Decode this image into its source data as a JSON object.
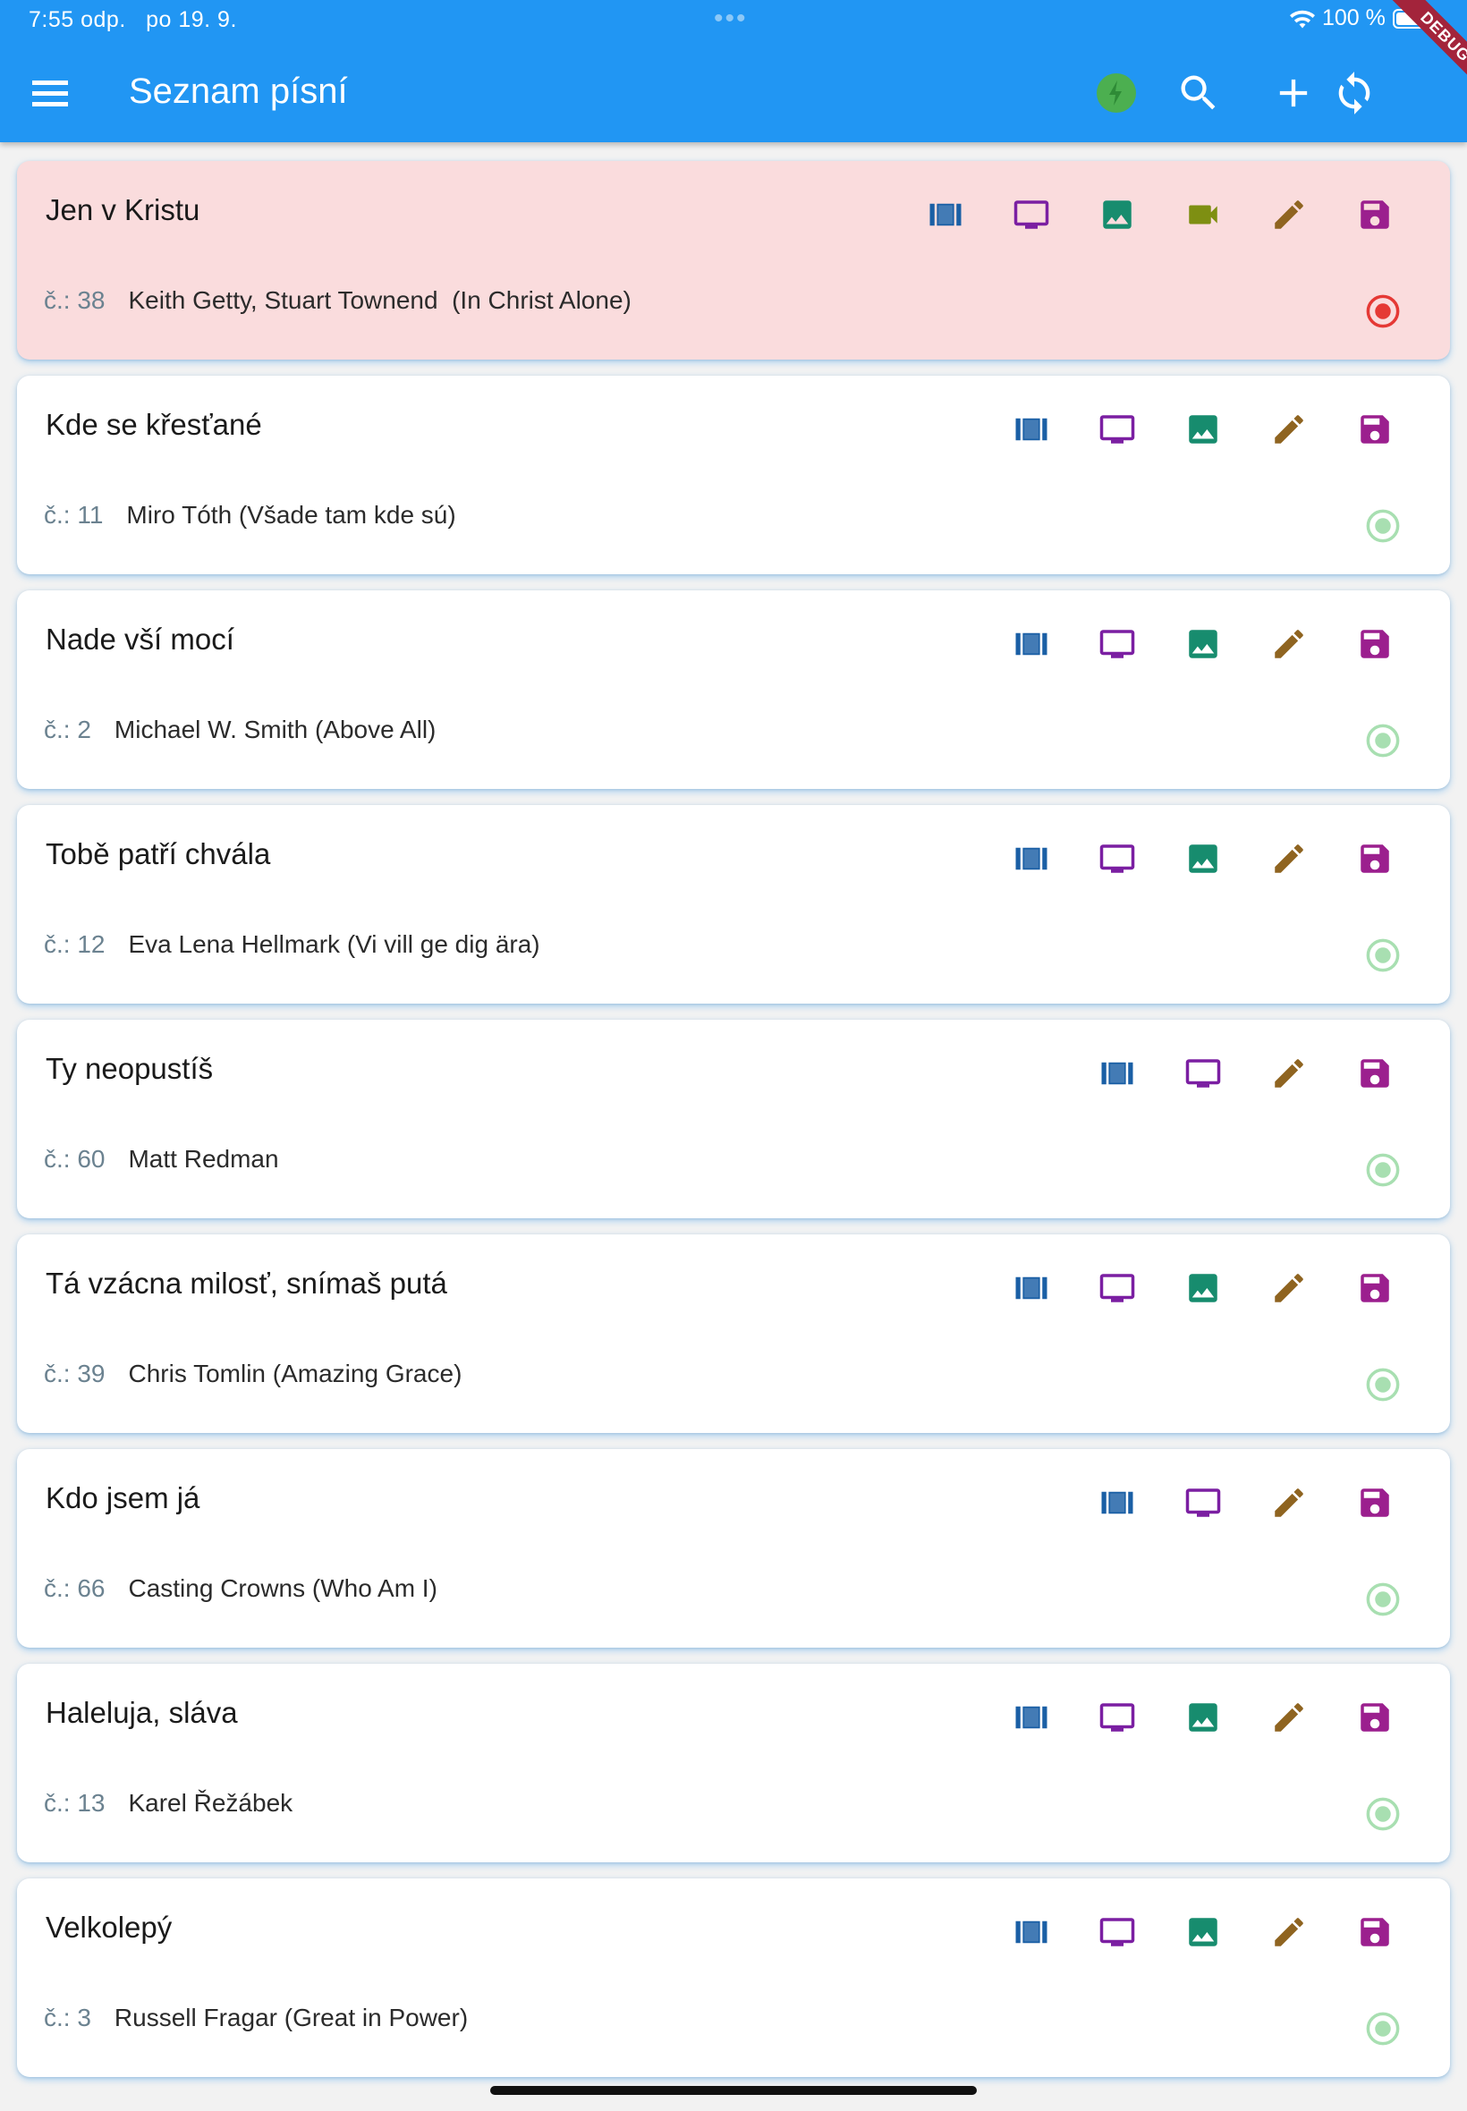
{
  "status_bar": {
    "time": "7:55 odp.",
    "date": "po 19. 9.",
    "battery": "100 %"
  },
  "debug_banner": "DEBUG",
  "app_bar": {
    "title": "Seznam písní",
    "icons": [
      "menu-icon",
      "status-dot-icon",
      "search-icon",
      "add-icon",
      "sync-icon"
    ]
  },
  "colors": {
    "app_bar": "#2196f3",
    "active_card": "#fadcdd",
    "slides_icon": "#1a5fa5",
    "presentation_icon": "#7b1fa2",
    "image_icon": "#178c6e",
    "video_icon": "#7e8f12",
    "edit_icon": "#8f6420",
    "save_icon": "#9b1f8e",
    "radio_selected": "#e53935",
    "radio_unselected": "#a8dfb1"
  },
  "songs": [
    {
      "title": "Jen v Kristu",
      "number": "č.: 38",
      "authors": "Keith Getty, Stuart Townend  (In Christ Alone)",
      "actions": [
        "slides",
        "presentation",
        "image",
        "video",
        "edit",
        "save"
      ],
      "selected": true
    },
    {
      "title": "Kde se křesťané",
      "number": "č.: 11",
      "authors": "Miro Tóth (Všade tam kde sú)",
      "actions": [
        "slides",
        "presentation",
        "image",
        "edit",
        "save"
      ],
      "selected": false
    },
    {
      "title": "Nade vší mocí",
      "number": "č.: 2",
      "authors": "Michael W. Smith (Above All)",
      "actions": [
        "slides",
        "presentation",
        "image",
        "edit",
        "save"
      ],
      "selected": false
    },
    {
      "title": "Tobě patří chvála",
      "number": "č.: 12",
      "authors": "Eva Lena Hellmark (Vi vill ge dig ära)",
      "actions": [
        "slides",
        "presentation",
        "image",
        "edit",
        "save"
      ],
      "selected": false
    },
    {
      "title": "Ty neopustíš",
      "number": "č.: 60",
      "authors": "Matt Redman",
      "actions": [
        "slides",
        "presentation",
        "edit",
        "save"
      ],
      "selected": false
    },
    {
      "title": "Tá vzácna milosť, snímaš putá",
      "number": "č.: 39",
      "authors": "Chris Tomlin (Amazing Grace)",
      "actions": [
        "slides",
        "presentation",
        "image",
        "edit",
        "save"
      ],
      "selected": false
    },
    {
      "title": "Kdo jsem já",
      "number": "č.: 66",
      "authors": "Casting Crowns (Who Am I)",
      "actions": [
        "slides",
        "presentation",
        "edit",
        "save"
      ],
      "selected": false
    },
    {
      "title": "Haleluja, sláva",
      "number": "č.: 13",
      "authors": "Karel Řežábek",
      "actions": [
        "slides",
        "presentation",
        "image",
        "edit",
        "save"
      ],
      "selected": false
    },
    {
      "title": "Velkolepý",
      "number": "č.: 3",
      "authors": "Russell Fragar (Great in Power)",
      "actions": [
        "slides",
        "presentation",
        "image",
        "edit",
        "save"
      ],
      "selected": false
    }
  ]
}
